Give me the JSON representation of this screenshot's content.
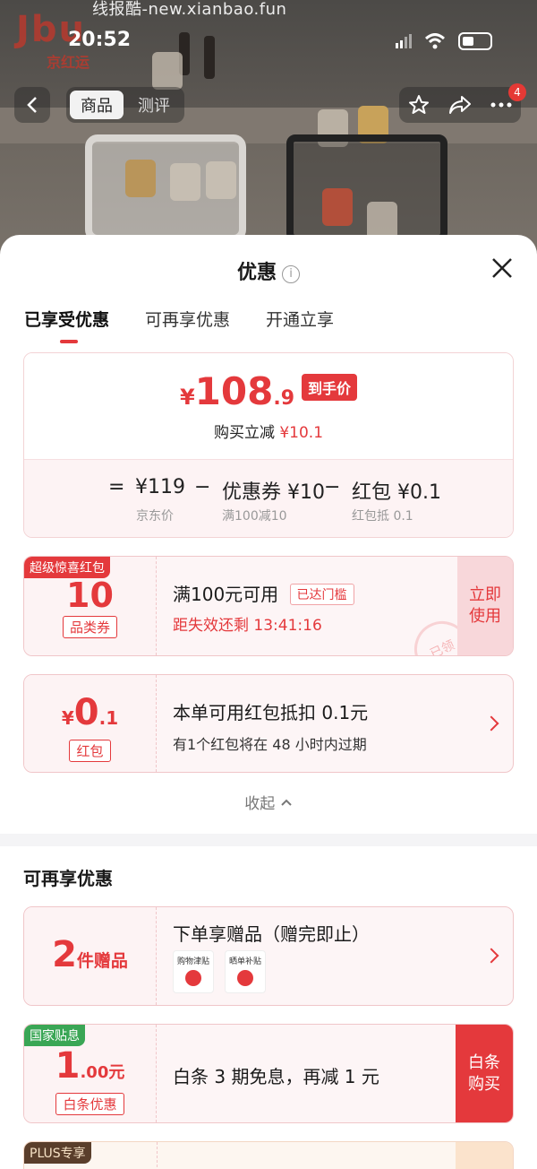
{
  "watermark": "线报酷-new.xianbao.fun",
  "status": {
    "time": "20:52"
  },
  "brand": {
    "logo": "Jbu",
    "sub": "京红运"
  },
  "nav": {
    "tabs": [
      {
        "label": "商品"
      },
      {
        "label": "测评"
      }
    ],
    "badge": "4"
  },
  "sheet": {
    "title": "优惠",
    "tabs": [
      {
        "label": "已享受优惠"
      },
      {
        "label": "可再享优惠"
      },
      {
        "label": "开通立享"
      }
    ],
    "price": {
      "yen": "¥",
      "int": "108",
      "dec": ".9",
      "tag": "到手价",
      "reduce_label": "购买立减",
      "reduce_value": "¥10.1"
    },
    "formula": {
      "eq": "=",
      "minus": "−",
      "items": [
        {
          "value": "¥119",
          "sub": "京东价"
        },
        {
          "value": "优惠券 ¥10",
          "sub": "满100减10"
        },
        {
          "value": "红包 ¥0.1",
          "sub": "红包抵 0.1"
        }
      ]
    },
    "coupon1": {
      "corner": "超级惊喜红包",
      "amount": "10",
      "type": "品类券",
      "title": "满100元可用",
      "badge": "已达门槛",
      "countdown": "距失效还剩 13:41:16",
      "action": "立即\n使用",
      "stamp": "已领"
    },
    "coupon2": {
      "yen": "¥",
      "int": "0",
      "dec": ".1",
      "type": "红包",
      "title": "本单可用红包抵扣 0.1元",
      "sub": "有1个红包将在 48 小时内过期"
    },
    "collapse": "收起",
    "more_title": "可再享优惠",
    "gift": {
      "num": "2",
      "unit": "件赠品",
      "title": "下单享赠品（赠完即止）",
      "thumbs": [
        "购物津贴",
        "晒单补贴"
      ]
    },
    "baitiao": {
      "corner": "国家贴息",
      "int": "1",
      "dec": ".00元",
      "type": "白条优惠",
      "title": "白条 3 期免息，再减 1 元",
      "action": "白条\n购买"
    },
    "plus": {
      "corner": "PLUS专享"
    }
  },
  "colors": {
    "accent": "#e4393c",
    "green": "#3aa655"
  }
}
